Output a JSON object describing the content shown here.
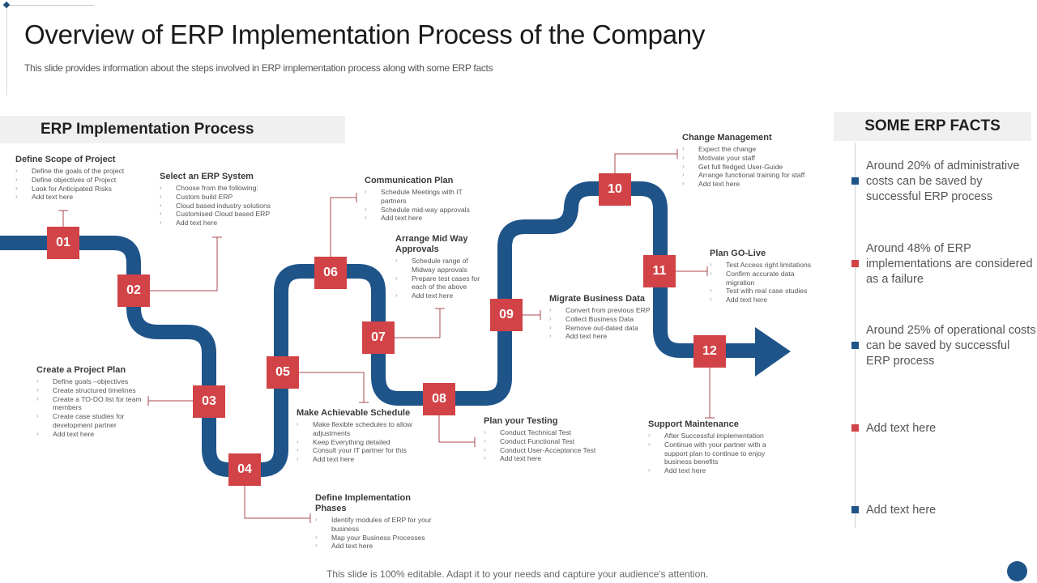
{
  "slide": {
    "title": "Overview of ERP Implementation Process of the Company",
    "subtitle": "This slide provides information about the steps involved in ERP implementation process along with some ERP facts",
    "footer": "This slide is 100% editable. Adapt it to your needs and capture your audience's attention."
  },
  "colors": {
    "road": "#1f5489",
    "step_box": "#d24347",
    "connector": "#a84a4f",
    "marker_blue": "#1f5489",
    "marker_red": "#d24347"
  },
  "process": {
    "header": "ERP Implementation Process",
    "steps": [
      {
        "number": "01",
        "title": "Define Scope of Project",
        "items": [
          "Define the goals of the project",
          "Define objectives of Project",
          "Look for Anticipated Risks",
          "Add text here"
        ]
      },
      {
        "number": "02",
        "title": "Select an ERP  System",
        "items": [
          "Choose  from the following:",
          "Custom build ERP",
          "Cloud based industry solutions",
          "Customised Cloud based ERP",
          "Add text here"
        ]
      },
      {
        "number": "03",
        "title": "Create a Project Plan",
        "items": [
          "Define goals –objectives",
          "Create structured timelines",
          "Create a TO-DO  list for team members",
          "Create case studies for development partner",
          "Add text here"
        ]
      },
      {
        "number": "04",
        "title": "Define Implementation Phases",
        "items": [
          "Identify modules of ERP for your business",
          "Map  your Business Processes",
          "Add text here"
        ]
      },
      {
        "number": "05",
        "title": "Make Achievable Schedule",
        "items": [
          "Make flexible schedules to allow adjustments",
          "Keep Everything detailed",
          "Consult your IT partner for this",
          "Add text here"
        ]
      },
      {
        "number": "06",
        "title": "Communication Plan",
        "items": [
          "Schedule Meetings  with IT partners",
          "Schedule mid-way approvals",
          "Add text here"
        ]
      },
      {
        "number": "07",
        "title": "Arrange Mid Way Approvals",
        "items": [
          "Schedule range  of Midway approvals",
          "Prepare  test cases for each of the above",
          "Add text here"
        ]
      },
      {
        "number": "08",
        "title": "Plan your Testing",
        "items": [
          "Conduct Technical Test",
          "Conduct Functional Test",
          "Conduct User-Acceptance Test",
          "Add text here"
        ]
      },
      {
        "number": "09",
        "title": "Migrate Business Data",
        "items": [
          "Convert from previous ERP",
          "Collect Business Data",
          "Remove out-dated data",
          "Add text here"
        ]
      },
      {
        "number": "10",
        "title": "Change Management",
        "items": [
          "Expect the change",
          "Motivate your staff",
          "Get  full fledged User-Guide",
          "Arrange  functional training for staff",
          "Add text here"
        ]
      },
      {
        "number": "11",
        "title": "Plan GO-Live",
        "items": [
          "Test Access right limitations",
          "Confirm accurate data migration",
          "Test with real case studies",
          "Add text here"
        ]
      },
      {
        "number": "12",
        "title": "Support Maintenance",
        "items": [
          "After Successful implementation",
          "Continue with your partner with a support plan to continue to enjoy business benefits",
          "Add text here"
        ]
      }
    ]
  },
  "facts": {
    "header": "SOME ERP FACTS",
    "items": [
      {
        "text": "Around 20% of administrative costs can be saved by successful ERP process",
        "marker": "blue"
      },
      {
        "text": "Around 48% of ERP implementations are considered as a failure",
        "marker": "red"
      },
      {
        "text": "Around 25% of operational costs can be saved by successful ERP process",
        "marker": "blue"
      },
      {
        "text": "Add text here",
        "marker": "red"
      },
      {
        "text": "Add text here",
        "marker": "blue"
      }
    ]
  }
}
